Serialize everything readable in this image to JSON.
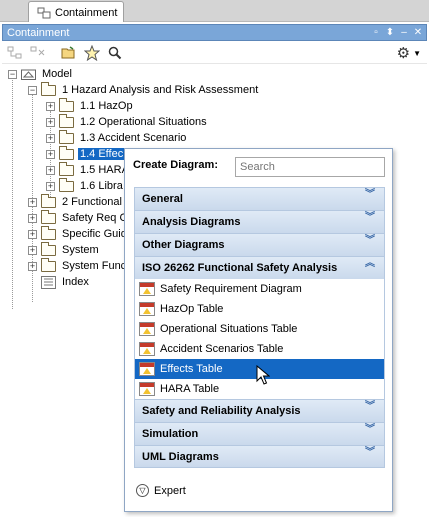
{
  "tab": {
    "label": "Containment"
  },
  "panel": {
    "title": "Containment"
  },
  "tree": {
    "root": "Model",
    "nodes": [
      {
        "label": "1 Hazard Analysis and Risk Assessment"
      },
      {
        "label": "1.1 HazOp"
      },
      {
        "label": "1.2 Operational Situations"
      },
      {
        "label": "1.3 Accident Scenario"
      },
      {
        "label": "1.4 Effec"
      },
      {
        "label": "1.5 HARA"
      },
      {
        "label": "1.6 Libra"
      },
      {
        "label": "2 Functional"
      },
      {
        "label": "Safety Req C"
      },
      {
        "label": "Specific Guid"
      },
      {
        "label": "System"
      },
      {
        "label": "System Func"
      },
      {
        "label": "Index"
      }
    ]
  },
  "popup": {
    "header": "Create Diagram:",
    "search_placeholder": "Search",
    "categories": [
      {
        "label": "General"
      },
      {
        "label": "Analysis Diagrams"
      },
      {
        "label": "Other Diagrams"
      },
      {
        "label": "ISO 26262 Functional Safety Analysis"
      }
    ],
    "items": [
      {
        "label": "Safety Requirement Diagram"
      },
      {
        "label": "HazOp Table"
      },
      {
        "label": "Operational Situations Table"
      },
      {
        "label": "Accident Scenarios Table"
      },
      {
        "label": "Effects Table"
      },
      {
        "label": "HARA Table"
      }
    ],
    "categories_after": [
      {
        "label": "Safety and Reliability Analysis"
      },
      {
        "label": "Simulation"
      },
      {
        "label": "UML Diagrams"
      }
    ],
    "expert_label": "Expert"
  },
  "colors": {
    "selection": "#1468c4",
    "titlebar": "#7aa6d8",
    "category": "#cad9ec"
  }
}
